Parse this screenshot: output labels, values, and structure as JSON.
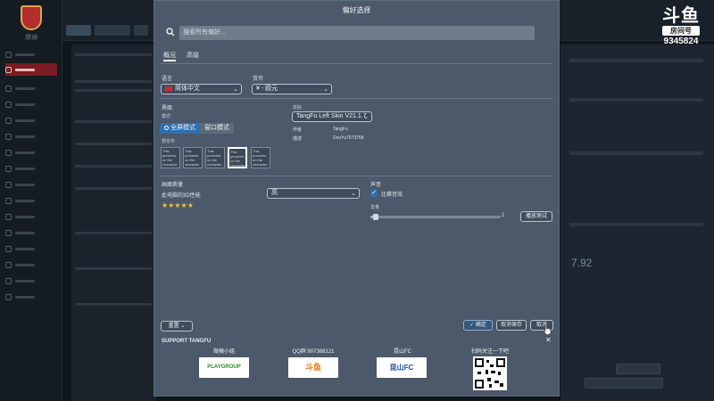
{
  "dialog": {
    "title": "偏好选择"
  },
  "search": {
    "placeholder": "搜索所有偏好..."
  },
  "tabs": [
    {
      "label": "概况",
      "active": true
    },
    {
      "label": "高级",
      "active": false
    }
  ],
  "language": {
    "label": "语言",
    "value": "简体中文"
  },
  "currency": {
    "label": "货币",
    "value": "¥ - 欧元"
  },
  "interface": {
    "label": "界面",
    "mode_label": "模式",
    "modes": [
      {
        "label": "全屏模式",
        "selected": true
      },
      {
        "label": "窗口模式",
        "selected": false
      }
    ],
    "preview_label": "预览布",
    "thumbs_text": "This presents on the character is the more"
  },
  "skin": {
    "label": "皮肤",
    "value": "TangFu Left Skin V21.1.7",
    "author_key": "作者",
    "author_value": "TangFu",
    "desc_key": "描述",
    "desc_value": "DouYu7073758"
  },
  "graphics": {
    "label": "画面质量",
    "desc": "此电脑的3D性能",
    "rating": "★★★★★",
    "quality_value": "高"
  },
  "sound": {
    "label": "声音",
    "checkbox_label": "比赛音效",
    "checked": true,
    "volume_label": "音量",
    "volume_value": "1",
    "volume_fraction": 0.04,
    "test_button": "播放测试"
  },
  "footer": {
    "reset_button": "重置",
    "confirm_button": "确定",
    "cancel_button": "取消保存",
    "apply_button": "取消"
  },
  "support": {
    "title": "SUPPORT TANGFU",
    "sponsors": [
      {
        "label": "微稿小组",
        "logo_text": "PLAYGROUP"
      },
      {
        "label": "QQ群:907368121",
        "logo_text": "斗鱼"
      },
      {
        "label": "昆山FC",
        "logo_text": "昆山FC"
      },
      {
        "label": "扫码关注一下吧",
        "logo_text": ""
      }
    ]
  },
  "stream_logo": {
    "brand": "斗鱼",
    "room_label": "房间号",
    "room_number": "9345824"
  },
  "background": {
    "logo_text": "摩纳",
    "right_value": "7.92"
  }
}
